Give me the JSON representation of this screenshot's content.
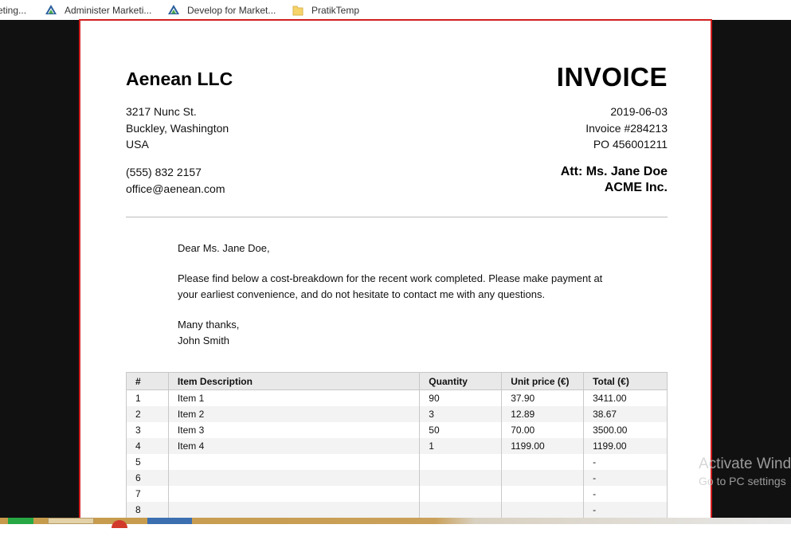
{
  "bookmarks": [
    {
      "label": "eting...",
      "icon": "page-icon"
    },
    {
      "label": "Administer Marketi...",
      "icon": "cloud-logo-icon"
    },
    {
      "label": "Develop for Market...",
      "icon": "cloud-logo-icon"
    },
    {
      "label": "PratikTemp",
      "icon": "folder-icon"
    }
  ],
  "invoice": {
    "company": {
      "name": "Aenean LLC",
      "address_line1": "3217 Nunc St.",
      "address_line2": "Buckley, Washington",
      "address_line3": "USA",
      "phone": "(555) 832 2157",
      "email": "office@aenean.com"
    },
    "title": "INVOICE",
    "date": "2019-06-03",
    "invoice_number": "Invoice #284213",
    "po": "PO 456001211",
    "attention": "Att: Ms. Jane Doe",
    "client": "ACME Inc.",
    "letter": {
      "greeting": "Dear Ms. Jane Doe,",
      "body_line1": "Please find below a cost-breakdown for the recent work completed. Please make payment at",
      "body_line2": "your earliest convenience, and do not hesitate to contact me with any questions.",
      "closing": "Many thanks,",
      "signature": "John Smith"
    },
    "table": {
      "headers": [
        "#",
        "Item Description",
        "Quantity",
        "Unit price (€)",
        "Total (€)"
      ],
      "rows": [
        [
          "1",
          "Item 1",
          "90",
          "37.90",
          "3411.00"
        ],
        [
          "2",
          "Item 2",
          "3",
          "12.89",
          "38.67"
        ],
        [
          "3",
          "Item 3",
          "50",
          "70.00",
          "3500.00"
        ],
        [
          "4",
          "Item 4",
          "1",
          "1199.00",
          "1199.00"
        ],
        [
          "5",
          "",
          "",
          "",
          "-"
        ],
        [
          "6",
          "",
          "",
          "",
          "-"
        ],
        [
          "7",
          "",
          "",
          "",
          "-"
        ],
        [
          "8",
          "",
          "",
          "",
          "-"
        ]
      ]
    }
  },
  "watermark": {
    "line1": "Activate Wind",
    "line2": "Go to PC settings"
  },
  "colors": {
    "page_border": "#d21f1f",
    "backdrop": "#111111",
    "header_row": "#e9e9e9"
  }
}
